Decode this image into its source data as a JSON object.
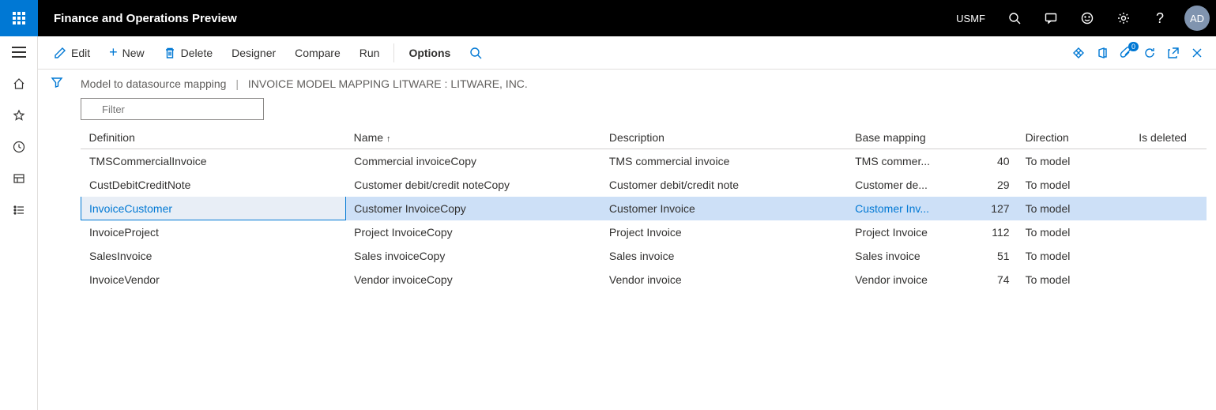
{
  "topbar": {
    "app_title": "Finance and Operations Preview",
    "company": "USMF",
    "avatar_initials": "AD"
  },
  "actions": {
    "edit": "Edit",
    "new": "New",
    "delete": "Delete",
    "designer": "Designer",
    "compare": "Compare",
    "run": "Run",
    "options": "Options"
  },
  "attach_badge": "0",
  "breadcrumb": {
    "part1": "Model to datasource mapping",
    "part2": "INVOICE MODEL MAPPING LITWARE : LITWARE, INC."
  },
  "filter": {
    "placeholder": "Filter"
  },
  "columns": {
    "definition": "Definition",
    "name": "Name",
    "description": "Description",
    "base_mapping": "Base mapping",
    "direction": "Direction",
    "is_deleted": "Is deleted"
  },
  "rows": [
    {
      "definition": "TMSCommercialInvoice",
      "name": "Commercial invoiceCopy",
      "description": "TMS commercial invoice",
      "base_mapping": "TMS commer...",
      "count": "40",
      "direction": "To model",
      "selected": false
    },
    {
      "definition": "CustDebitCreditNote",
      "name": "Customer debit/credit noteCopy",
      "description": "Customer debit/credit note",
      "base_mapping": "Customer de...",
      "count": "29",
      "direction": "To model",
      "selected": false
    },
    {
      "definition": "InvoiceCustomer",
      "name": "Customer InvoiceCopy",
      "description": "Customer Invoice",
      "base_mapping": "Customer Inv...",
      "count": "127",
      "direction": "To model",
      "selected": true
    },
    {
      "definition": "InvoiceProject",
      "name": "Project InvoiceCopy",
      "description": "Project Invoice",
      "base_mapping": "Project Invoice",
      "count": "112",
      "direction": "To model",
      "selected": false
    },
    {
      "definition": "SalesInvoice",
      "name": "Sales invoiceCopy",
      "description": "Sales invoice",
      "base_mapping": "Sales invoice",
      "count": "51",
      "direction": "To model",
      "selected": false
    },
    {
      "definition": "InvoiceVendor",
      "name": "Vendor invoiceCopy",
      "description": "Vendor invoice",
      "base_mapping": "Vendor invoice",
      "count": "74",
      "direction": "To model",
      "selected": false
    }
  ]
}
